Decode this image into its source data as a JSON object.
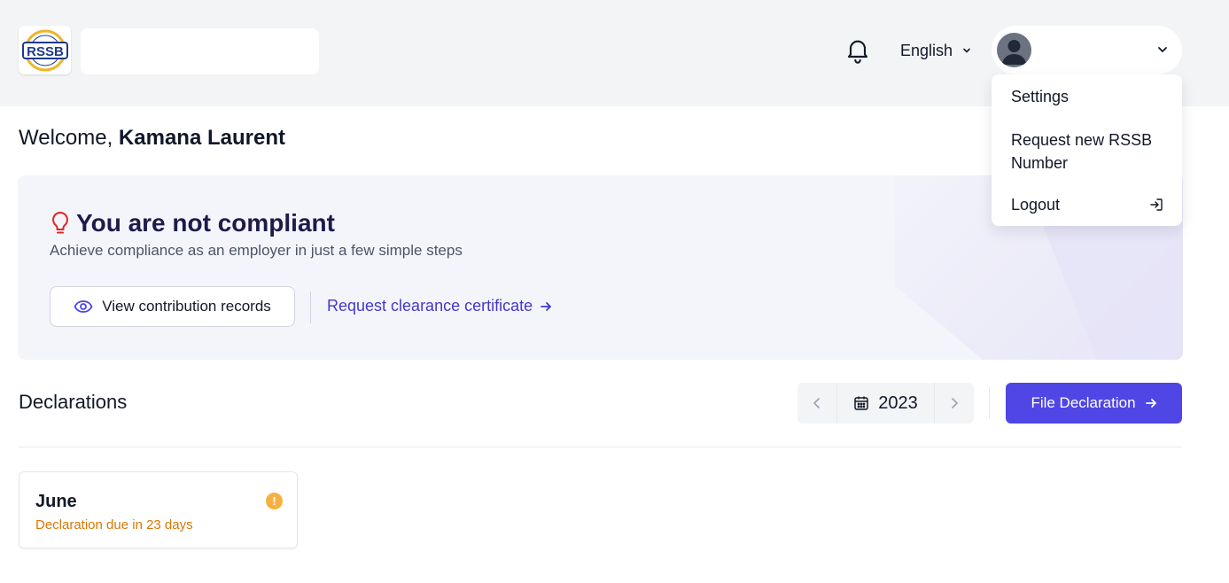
{
  "header": {
    "logo_alt": "RSSB",
    "language": "English",
    "icons": {
      "bell": "bell-icon",
      "chevron": "chevron-down-icon"
    }
  },
  "profile_menu": {
    "items": [
      {
        "label": "Settings"
      },
      {
        "label": "Request new RSSB Number"
      },
      {
        "label": "Logout",
        "icon": "logout-icon"
      }
    ]
  },
  "welcome": {
    "prefix": "Welcome, ",
    "name": "Kamana Laurent"
  },
  "compliance": {
    "title": "You are not compliant",
    "subtitle": "Achieve compliance as an employer in just a few simple steps",
    "view_button": "View contribution records",
    "request_link": "Request clearance certificate",
    "icon": "lightbulb-icon"
  },
  "declarations": {
    "title": "Declarations",
    "year": "2023",
    "file_button": "File Declaration",
    "cards": [
      {
        "month": "June",
        "status": "Declaration due in 23 days",
        "status_color": "#d97706"
      }
    ]
  },
  "colors": {
    "accent": "#4f46e5",
    "warning": "#f6b042",
    "title": "#1e1b4b",
    "alert_icon": "#dc2626"
  }
}
